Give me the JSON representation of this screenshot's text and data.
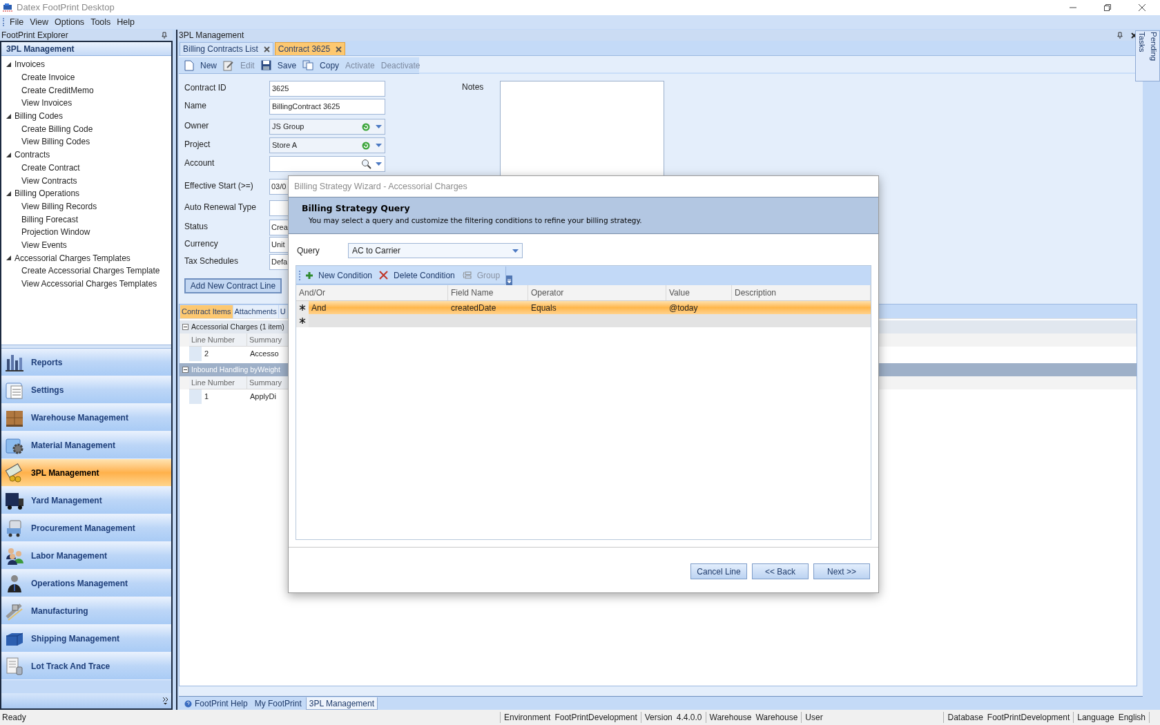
{
  "window": {
    "title": "Datex FootPrint Desktop"
  },
  "menu": [
    "File",
    "View",
    "Options",
    "Tools",
    "Help"
  ],
  "explorer": {
    "title": "FootPrint Explorer",
    "section": "3PL Management",
    "tree": [
      {
        "label": "Invoices",
        "expanded": true,
        "children": [
          {
            "label": "Create Invoice"
          },
          {
            "label": "Create CreditMemo"
          },
          {
            "label": "View Invoices"
          }
        ]
      },
      {
        "label": "Billing Codes",
        "expanded": true,
        "children": [
          {
            "label": "Create Billing Code"
          },
          {
            "label": "View Billing Codes"
          }
        ]
      },
      {
        "label": "Contracts",
        "expanded": true,
        "children": [
          {
            "label": "Create Contract"
          },
          {
            "label": "View Contracts"
          }
        ]
      },
      {
        "label": "Billing Operations",
        "expanded": true,
        "children": [
          {
            "label": "View Billing Records"
          },
          {
            "label": "Billing Forecast"
          },
          {
            "label": "Projection Window"
          },
          {
            "label": "View Events"
          }
        ]
      },
      {
        "label": "Accessorial Charges Templates",
        "expanded": true,
        "children": [
          {
            "label": "Create Accessorial Charges Template"
          },
          {
            "label": "View Accessorial Charges Templates"
          }
        ]
      }
    ]
  },
  "nav": [
    {
      "label": "Reports",
      "selected": false
    },
    {
      "label": "Settings",
      "selected": false
    },
    {
      "label": "Warehouse Management",
      "selected": false
    },
    {
      "label": "Material Management",
      "selected": false
    },
    {
      "label": "3PL Management",
      "selected": true
    },
    {
      "label": "Yard Management",
      "selected": false
    },
    {
      "label": "Procurement Management",
      "selected": false
    },
    {
      "label": "Labor Management",
      "selected": false
    },
    {
      "label": "Operations Management",
      "selected": false
    },
    {
      "label": "Manufacturing",
      "selected": false
    },
    {
      "label": "Shipping Management",
      "selected": false
    },
    {
      "label": "Lot Track And Trace",
      "selected": false
    }
  ],
  "workspace": {
    "title": "3PL Management",
    "tabs": [
      {
        "label": "Billing Contracts List",
        "selected": false
      },
      {
        "label": "Contract 3625",
        "selected": true
      }
    ],
    "toolbar": [
      {
        "label": "New",
        "disabled": false
      },
      {
        "label": "Edit",
        "disabled": true
      },
      {
        "label": "Save",
        "disabled": false
      },
      {
        "label": "Copy",
        "disabled": false
      },
      {
        "label": "Activate",
        "disabled": true
      },
      {
        "label": "Deactivate",
        "disabled": true
      }
    ],
    "fields": [
      {
        "label": "Contract ID",
        "kind": "text",
        "value": "3625"
      },
      {
        "label": "Name",
        "kind": "text",
        "value": "BillingContract 3625"
      },
      {
        "label": "Owner",
        "kind": "combo",
        "value": "JS Group"
      },
      {
        "label": "Project",
        "kind": "combo",
        "value": "Store A"
      },
      {
        "label": "Account",
        "kind": "lookup"
      },
      {
        "label": "Effective Start (>=)",
        "kind": "text",
        "value": "03/0"
      },
      {
        "label": "Auto Renewal Type",
        "kind": "text"
      },
      {
        "label": "Status",
        "kind": "text",
        "value": "Crea"
      },
      {
        "label": "Currency",
        "kind": "text",
        "value": "Unit"
      },
      {
        "label": "Tax Schedules",
        "kind": "text",
        "value": "Defa"
      }
    ],
    "notes_label": "Notes",
    "add_line_button": "Add New Contract Line",
    "item_tabs": [
      {
        "label": "Contract Items",
        "selected": true
      },
      {
        "label": "Attachments",
        "selected": false
      },
      {
        "label": "U",
        "selected": false
      }
    ],
    "groups": [
      {
        "title": "Accessorial Charges (1 item)",
        "selected": false,
        "columns": [
          "Line Number",
          "Summary"
        ],
        "rows": [
          [
            "2",
            "Accesso"
          ]
        ]
      },
      {
        "title": "Inbound Handling byWeight",
        "selected": true,
        "columns": [
          "Line Number",
          "Summary"
        ],
        "rows": [
          [
            "1",
            "ApplyDi"
          ]
        ]
      }
    ]
  },
  "bottom_tabs": [
    {
      "label": "FootPrint Help",
      "selected": false
    },
    {
      "label": "My FootPrint",
      "selected": false
    },
    {
      "label": "3PL Management",
      "selected": true
    }
  ],
  "pending_tasks": "Pending Tasks",
  "status_bar": {
    "message": "Ready",
    "items": [
      {
        "label": "Environment",
        "value": "FootPrintDevelopment"
      },
      {
        "label": "Version",
        "value": "4.4.0.0"
      },
      {
        "label": "Warehouse",
        "value": "Warehouse"
      },
      {
        "label": "User"
      }
    ],
    "right_items": [
      {
        "label": "Database",
        "value": "FootPrintDevelopment"
      },
      {
        "label": "Language",
        "value": "English"
      }
    ]
  },
  "dialog": {
    "title": "Billing Strategy Wizard - Accessorial Charges",
    "heading": "Billing Strategy Query",
    "description": "You may select a query and customize the filtering conditions to refine your billing strategy.",
    "query_label": "Query",
    "query_value": "AC to Carrier",
    "toolbar": [
      {
        "label": "New Condition",
        "disabled": false
      },
      {
        "label": "Delete Condition",
        "disabled": false
      },
      {
        "label": "Group",
        "disabled": true
      }
    ],
    "columns": [
      "And/Or",
      "Field Name",
      "Operator",
      "Value",
      "Description"
    ],
    "rows": [
      {
        "selected": true,
        "cells": [
          "And",
          "createdDate",
          "Equals",
          "@today",
          ""
        ]
      }
    ],
    "buttons": [
      "Cancel Line",
      "<< Back",
      "Next >>"
    ]
  }
}
